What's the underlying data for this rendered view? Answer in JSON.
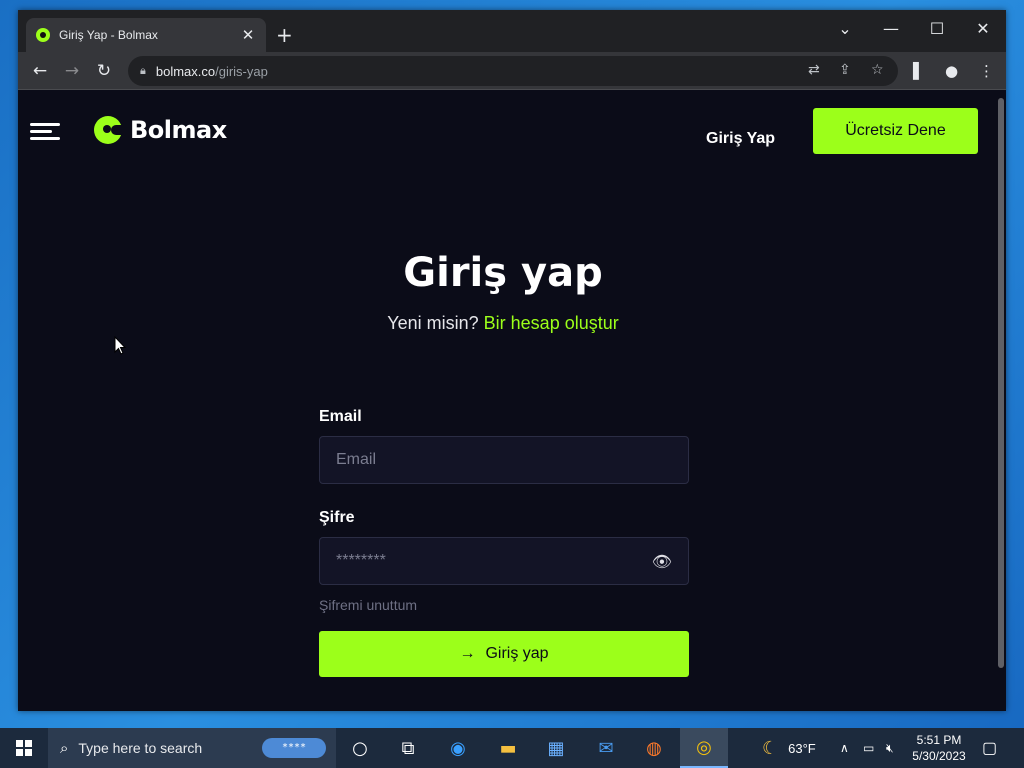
{
  "browser": {
    "tab_title": "Giriş Yap - Bolmax",
    "tab_close": "✕",
    "new_tab": "+",
    "url_host": "bolmax.co",
    "url_path": "/giris-yap",
    "window_controls": {
      "chevron": "⌄",
      "minimize": "—",
      "maximize": "☐",
      "close": "✕"
    }
  },
  "site": {
    "logo_text": "Bolmax",
    "nav_login": "Giriş Yap",
    "cta": "Ücretsiz Dene",
    "heading": "Giriş yap",
    "subline_question": "Yeni misin?",
    "subline_link": "Bir hesap oluştur",
    "email_label": "Email",
    "email_placeholder": "Email",
    "password_label": "Şifre",
    "password_value": "********",
    "forgot": "Şifremi unuttum",
    "submit": "Giriş yap",
    "accent_color": "#9cff1a",
    "background_color": "#0b0c18"
  },
  "taskbar": {
    "search_placeholder": "Type here to search",
    "search_badge": "****",
    "weather_temp": "63°F",
    "time": "5:51 PM",
    "date": "5/30/2023"
  }
}
